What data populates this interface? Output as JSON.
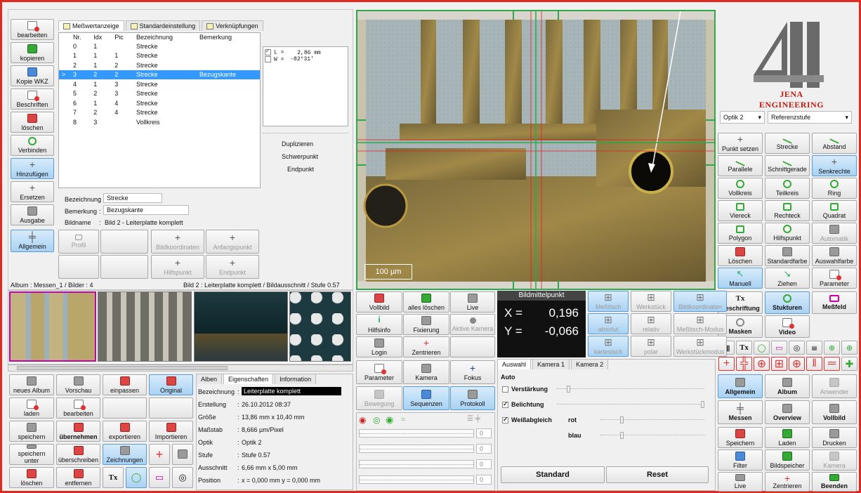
{
  "colors": {
    "frame": "#e02a1d",
    "selection": "#3399ff",
    "active_button": "#a9d2f3",
    "crosshair": "#2ea84a",
    "readout_bg": "#111111"
  },
  "left_toolbar": [
    {
      "label": "bearbeiten",
      "icon": "edit-icon"
    },
    {
      "label": "kopieren",
      "icon": "copy-icon"
    },
    {
      "label": "Kopie WKZ",
      "icon": "tool-copy-icon"
    },
    {
      "label": "Beschriften",
      "icon": "label-icon"
    },
    {
      "label": "löschen",
      "icon": "delete-icon"
    },
    {
      "label": "Verbinden",
      "icon": "connect-icon"
    },
    {
      "label": "Hinzufügen",
      "icon": "add-icon",
      "active": true
    },
    {
      "label": "Ersetzen",
      "icon": "replace-icon"
    },
    {
      "label": "Ausgabe",
      "icon": "print-icon"
    },
    {
      "label": "Allgemein",
      "icon": "general-icon",
      "active": true
    }
  ],
  "tabs": [
    "Meßwertanzeige",
    "Standardeinstellung",
    "Verknüpfungen"
  ],
  "measure_table": {
    "columns": [
      "Nr.",
      "Idx",
      "Pic",
      "Bezeichnung",
      "Bemerkung"
    ],
    "rows": [
      {
        "nr": "0",
        "idx": "1",
        "pic": "",
        "name": "Strecke",
        "note": ""
      },
      {
        "nr": "1",
        "idx": "1",
        "pic": "1",
        "name": "Strecke",
        "note": ""
      },
      {
        "nr": "2",
        "idx": "1",
        "pic": "2",
        "name": "Strecke",
        "note": ""
      },
      {
        "nr": "3",
        "idx": "2",
        "pic": "2",
        "name": "Strecke",
        "note": "Bezugskante",
        "selected": true
      },
      {
        "nr": "4",
        "idx": "1",
        "pic": "3",
        "name": "Strecke",
        "note": ""
      },
      {
        "nr": "5",
        "idx": "2",
        "pic": "3",
        "name": "Strecke",
        "note": ""
      },
      {
        "nr": "6",
        "idx": "1",
        "pic": "4",
        "name": "Strecke",
        "note": ""
      },
      {
        "nr": "7",
        "idx": "2",
        "pic": "4",
        "name": "Strecke",
        "note": ""
      },
      {
        "nr": "8",
        "idx": "3",
        "pic": "",
        "name": "Vollkreis",
        "note": ""
      }
    ]
  },
  "values_box": {
    "l_label": "L",
    "l_eq": "=",
    "l_value": "2,86 mm",
    "w_label": "W",
    "w_eq": "=",
    "w_value": "-82°31'"
  },
  "side_actions": [
    "Duplizieren",
    "Schwerpunkt",
    "Endpunkt"
  ],
  "details": {
    "bez_label": "Bezeichnung",
    "bez_value": "Strecke",
    "bem_label": "Bemerkung",
    "bem_value": "Bezugskante",
    "bild_label": "Bildname",
    "bild_value": "Bild 2 - Leiterplatte komplett"
  },
  "sub_buttons": [
    "Profil",
    "Bildkoordinaten",
    "Anfangspunkt",
    "Hilfspunkt",
    "Endpunkt"
  ],
  "status": {
    "left": "Album : Messen_1 / Bilder : 4",
    "right": "Bild 2 : Leiterplatte komplett / Bildausschnitt / Stufe 0.57"
  },
  "scalebar": "100 µm",
  "mid_buttons": [
    "Vollbild",
    "alles löschen",
    "Live",
    "Hilfsinfo",
    "Fixierung",
    "Aktive Kamera",
    "Login",
    "Zentrieren"
  ],
  "readout": {
    "title": "Bildmittelpunkt",
    "x_label": "X =",
    "x_value": "0,196",
    "y_label": "Y =",
    "y_value": "-0,066"
  },
  "mode_buttons": [
    "Meßtisch",
    "Werkstück",
    "Bildkoordinaten",
    "absolut",
    "relativ",
    "Meßtisch-Modus",
    "kartesisch",
    "polar",
    "Werkstückmodus"
  ],
  "album_buttons": [
    "neues Album",
    "Vorschau",
    "einpassen",
    "Original",
    "laden",
    "bearbeiten",
    "speichern",
    "übernehmen",
    "exportieren",
    "Importieren",
    "speichern unter",
    "überschreiben",
    "Zeichnungen",
    "löschen",
    "entfernen"
  ],
  "info_tabs": [
    "Alben",
    "Eigenschaften",
    "Information"
  ],
  "properties": [
    {
      "k": "Bezeichnung",
      "v": "Leiterplatte komplett"
    },
    {
      "k": "Erstellung",
      "v": "26.10.2012  08:37"
    },
    {
      "k": "Größe",
      "v": "13,86 mm x 10,40 mm"
    },
    {
      "k": "Maßstab",
      "v": "8,666 µm/Pixel"
    },
    {
      "k": "Optik",
      "v": "Optik 2"
    },
    {
      "k": "Stufe",
      "v": "Stufe 0.57"
    },
    {
      "k": "Ausschnitt",
      "v": "6,66 mm x 5,00 mm"
    },
    {
      "k": "Position",
      "v": "x = 0,000 mm    y = 0,000 mm"
    }
  ],
  "param_buttons": [
    "Parameter",
    "Kamera",
    "Fokus",
    "Bewegung",
    "Sequenzen",
    "Protokoll"
  ],
  "slider_values": [
    "0",
    "0",
    "0",
    "0"
  ],
  "camera_tabs": [
    "Auswahl",
    "Kamera 1",
    "Kamera 2"
  ],
  "camera": {
    "auto": "Auto",
    "gain": "Verstärkung",
    "exposure": "Belichtung",
    "wb": "Weißabgleich",
    "red": "rot",
    "blue": "blau",
    "standard": "Standard",
    "reset": "Reset"
  },
  "logo": {
    "text": "JENA ENGINEERING"
  },
  "dropdowns": {
    "optics": "Optik 2",
    "reference": "Referenzstufe"
  },
  "tools": [
    "Punkt setzen",
    "Strecke",
    "Abstand",
    "Parallele",
    "Schnittgerade",
    "Senkrechte",
    "Vollkreis",
    "Teilkreis",
    "Ring",
    "Viereck",
    "Rechteck",
    "Quadrat",
    "Polygon",
    "Hilfspunkt",
    "Automatik",
    "Löschen",
    "Standardfarbe",
    "Auswahlfarbe",
    "Manuell",
    "Ziehen",
    "Parameter"
  ],
  "overlay_buttons": [
    "Beschriftung",
    "Stukturen",
    "Meßfeld",
    "Masken",
    "Video"
  ],
  "nav_buttons": [
    "Allgemein",
    "Album",
    "Anwender",
    "Messen",
    "Overview",
    "Vollbild"
  ],
  "bottom_buttons": [
    "Speichern",
    "Laden",
    "Drucken",
    "Filter",
    "Bildspeicher",
    "Kamera",
    "Live",
    "Zentrieren",
    "Beenden"
  ]
}
